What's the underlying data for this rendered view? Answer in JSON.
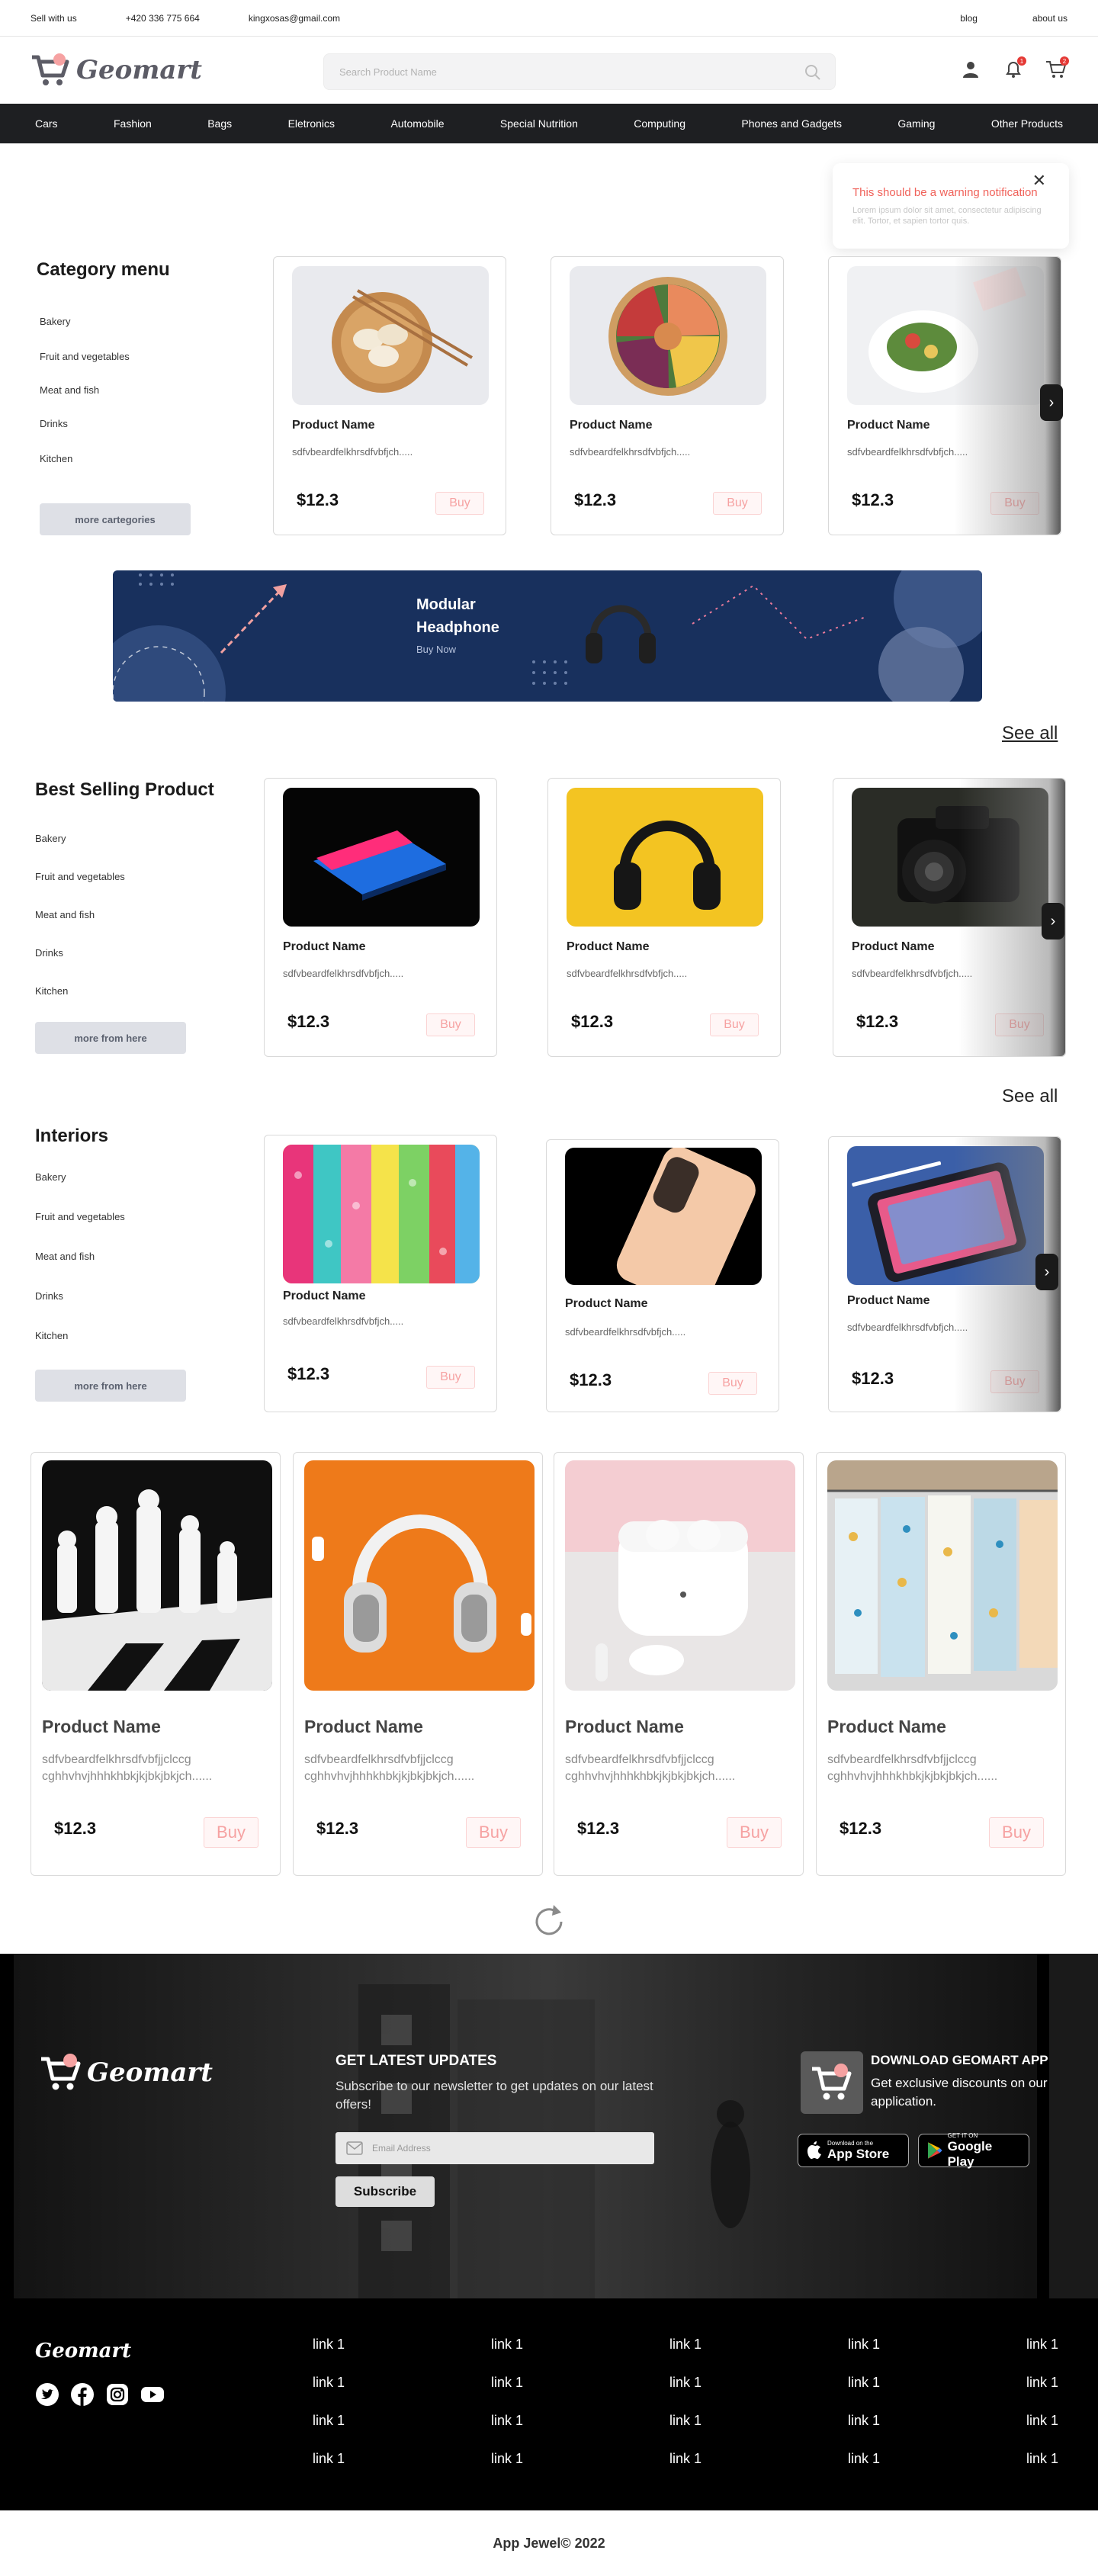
{
  "topbar": {
    "sell": "Sell with us",
    "phone": "+420 336 775 664",
    "email": "kingxosas@gmail.com",
    "blog": "blog",
    "about": "about us"
  },
  "header": {
    "logo": "Geomart",
    "search_placeholder": "Search Product Name",
    "notification_count": "1",
    "cart_count": "2"
  },
  "nav": [
    "Cars",
    "Fashion",
    "Bags",
    "Eletronics",
    "Automobile",
    "Special Nutrition",
    "Computing",
    "Phones and Gadgets",
    "Gaming",
    "Other Products"
  ],
  "toast": {
    "title": "This should be a warning notification",
    "message": "Lorem ipsum dolor sit amet, consectetur adipiscing elit. Tortor, et sapien tortor quis.",
    "close": "✕"
  },
  "category_menu": {
    "title": "Category menu",
    "items": [
      "Bakery",
      "Fruit and vegetables",
      "Meat and fish",
      "Drinks",
      "Kitchen"
    ],
    "button": "more cartegories",
    "products": [
      {
        "name": "Product Name",
        "desc": "sdfvbeardfelkhrsdfvbfjch.....",
        "price": "$12.3",
        "buy": "Buy",
        "image": "dumplings-bowl"
      },
      {
        "name": "Product Name",
        "desc": "sdfvbeardfelkhrsdfvbfjch.....",
        "price": "$12.3",
        "buy": "Buy",
        "image": "poke-bowl"
      },
      {
        "name": "Product Name",
        "desc": "sdfvbeardfelkhrsdfvbfjch.....",
        "price": "$12.3",
        "buy": "Buy",
        "image": "salad-plate"
      }
    ]
  },
  "banner": {
    "title": "Modular Headphone",
    "cta": "Buy Now"
  },
  "best_selling": {
    "see_all": "See all",
    "title": "Best Selling Product",
    "items": [
      "Bakery",
      "Fruit and vegetables",
      "Meat and fish",
      "Drinks",
      "Kitchen"
    ],
    "button": "more from here",
    "products": [
      {
        "name": "Product Name",
        "desc": "sdfvbeardfelkhrsdfvbfjch.....",
        "price": "$12.3",
        "buy": "Buy",
        "image": "laptop"
      },
      {
        "name": "Product Name",
        "desc": "sdfvbeardfelkhrsdfvbfjch.....",
        "price": "$12.3",
        "buy": "Buy",
        "image": "headphones-yellow"
      },
      {
        "name": "Product Name",
        "desc": "sdfvbeardfelkhrsdfvbfjch.....",
        "price": "$12.3",
        "buy": "Buy",
        "image": "camera"
      }
    ]
  },
  "interiors": {
    "see_all": "See all",
    "title": "Interiors",
    "items": [
      "Bakery",
      "Fruit and vegetables",
      "Meat and fish",
      "Drinks",
      "Kitchen"
    ],
    "button": "more from here",
    "products": [
      {
        "name": "Product Name",
        "desc": "sdfvbeardfelkhrsdfvbfjch.....",
        "price": "$12.3",
        "buy": "Buy",
        "image": "fabrics"
      },
      {
        "name": "Product Name",
        "desc": "sdfvbeardfelkhrsdfvbfjch.....",
        "price": "$12.3",
        "buy": "Buy",
        "image": "iphone"
      },
      {
        "name": "Product Name",
        "desc": "sdfvbeardfelkhrsdfvbfjch.....",
        "price": "$12.3",
        "buy": "Buy",
        "image": "tablet"
      }
    ]
  },
  "featured": [
    {
      "name": "Product Name",
      "desc": "sdfvbeardfelkhrsdfvbfjjclccg cghhvhvjhhhkhbkjkjbkjbkjch......",
      "price": "$12.3",
      "buy": "Buy",
      "image": "chess"
    },
    {
      "name": "Product Name",
      "desc": "sdfvbeardfelkhrsdfvbfjjclccg cghhvhvjhhhkhbkjkjbkjbkjch......",
      "price": "$12.3",
      "buy": "Buy",
      "image": "airpods-max"
    },
    {
      "name": "Product Name",
      "desc": "sdfvbeardfelkhrsdfvbfjjclccg cghhvhvjhhhkhbkjkjbkjbkjch......",
      "price": "$12.3",
      "buy": "Buy",
      "image": "airpods-pro"
    },
    {
      "name": "Product Name",
      "desc": "sdfvbeardfelkhrsdfvbfjjclccg cghhvhvjhhhkhbkjkjbkjbkjch......",
      "price": "$12.3",
      "buy": "Buy",
      "image": "clothes-rack"
    }
  ],
  "newsletter": {
    "logo": "Geomart",
    "title": "GET LATEST UPDATES",
    "text": "Subscribe to our newsletter to get updates on our latest offers!",
    "email_placeholder": "Email Address",
    "button": "Subscribe",
    "app_title": "DOWNLOAD  GEOMART APP",
    "app_text": "Get exclusive discounts on our application.",
    "appstore_small": "Download on the",
    "appstore_big": "App Store",
    "play_small": "GET IT ON",
    "play_big": "Google Play"
  },
  "footer": {
    "logo": "Geomart",
    "social": [
      "twitter-icon",
      "facebook-icon",
      "instagram-icon",
      "youtube-icon"
    ],
    "links": [
      [
        "link 1",
        "link 1",
        "link 1",
        "link 1",
        "link 1"
      ],
      [
        "link 1",
        "link 1",
        "link 1",
        "link 1",
        "link 1"
      ],
      [
        "link 1",
        "link 1",
        "link 1",
        "link 1",
        "link 1"
      ],
      [
        "link 1",
        "link 1",
        "link 1",
        "link 1",
        "link 1"
      ]
    ],
    "copyright": "App Jewel© 2022"
  },
  "colors": {
    "nav_bg": "#1e1f22",
    "accent_buy": "#f6a2a2",
    "banner_bg": "#18305d",
    "warning": "#f0625a"
  }
}
